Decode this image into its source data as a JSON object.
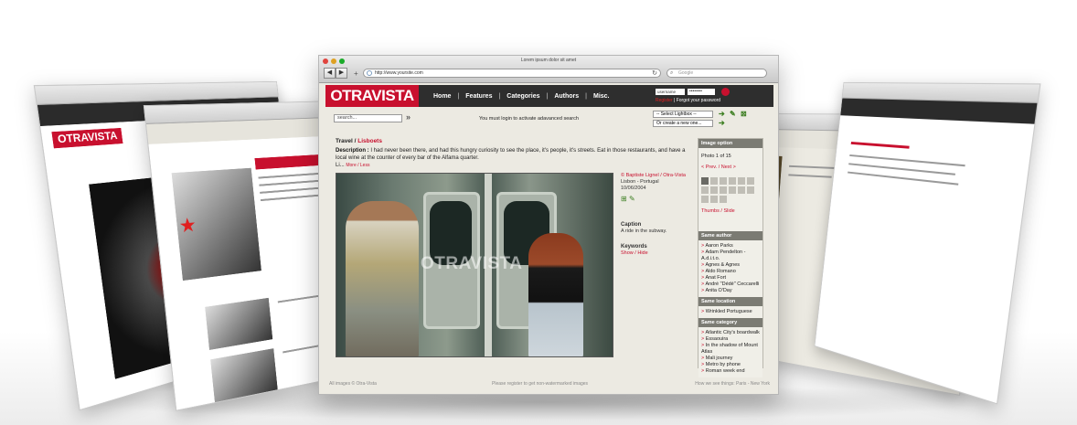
{
  "window_title": "Lorem ipsum dolor sit amet",
  "url": "http://www.yoursite.com",
  "google_search_placeholder": "Google",
  "logo": "OTRAVISTA",
  "nav": [
    "Home",
    "Features",
    "Categories",
    "Authors",
    "Misc."
  ],
  "login": {
    "username": "username",
    "password": "••••••••",
    "register": "Register",
    "forgot": "Forgot your password"
  },
  "search": {
    "placeholder": "search...",
    "advanced_notice": "You must login to activate adavanced search"
  },
  "lightbox": {
    "select": "-- Select Lightbox --",
    "create": "Or create a new one..."
  },
  "breadcrumb": {
    "category": "Travel",
    "item": "Lisboets"
  },
  "description": {
    "label": "Description :",
    "text": "I had never been there, and had this hungry curiosity to see the place, it's people, it's streets. Eat in those restaurants, and have a local wine at the counter of every bar of the Alfama quarter.",
    "tail": "Li...",
    "more": "More / Less"
  },
  "photo": {
    "watermark": "OTRAVISTA",
    "credit": "© Baptiste Lignel / Otra-Vista",
    "location": "Lisbon - Portugal",
    "date": "10/06/2004",
    "caption_label": "Caption",
    "caption": "A ride in the subway.",
    "keywords_label": "Keywords",
    "keywords_toggle": "Show / Hide"
  },
  "sidebar": {
    "image_option_title": "Image option",
    "photo_count": "Photo 1 of 15",
    "prev_next": "< Prev. / Next >",
    "thumbs_slide": "Thumbs / Slide",
    "same_author_title": "Same author",
    "same_author": [
      "Aaron Parks",
      "Adam Pendelton - A.d.i.t.o.",
      "Agnes & Agnes",
      "Aldo Romano",
      "Anat Fort",
      "André \"Dédé\" Ceccarelli",
      "Anita O'Day"
    ],
    "same_location_title": "Same location",
    "same_location": [
      "Wrinkled Portuguese"
    ],
    "same_category_title": "Same category",
    "same_category": [
      "Atlantic City's boardwalk",
      "Essaouira",
      "In the shadow of Mount Atlas",
      "Mali journey",
      "Metro by phone",
      "Roman week end"
    ]
  },
  "footer": {
    "left": "All images © Otra-Vista",
    "center": "Please register to get non-watermarked images",
    "right": "How we see things: Paris - New York"
  },
  "colors": {
    "brand_red": "#c8102e",
    "header_dark": "#2e2e2e",
    "panel_bg": "#eceae2"
  }
}
